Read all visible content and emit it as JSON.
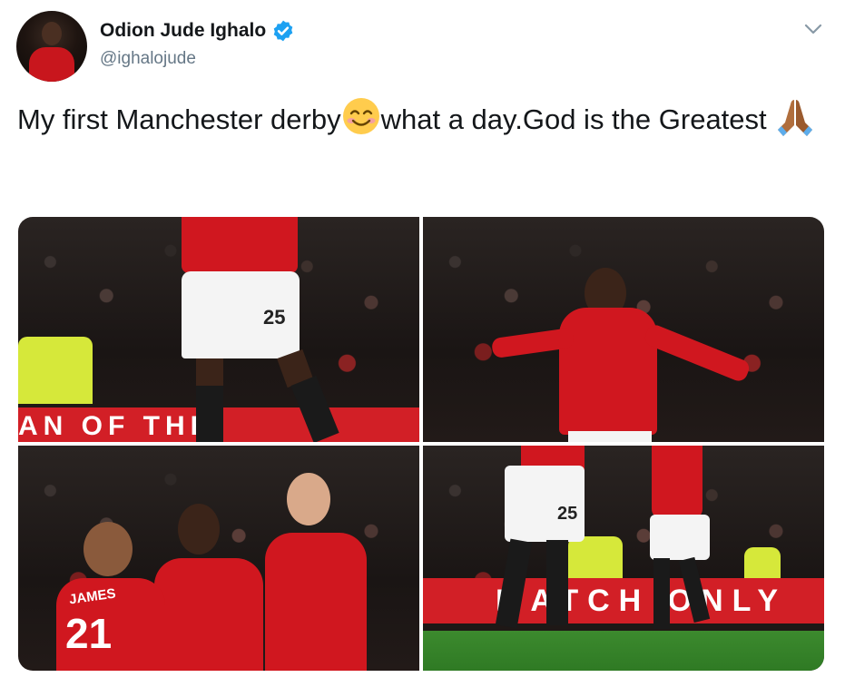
{
  "author": {
    "display_name": "Odion Jude Ighalo",
    "handle": "@ighalojude",
    "verified": true
  },
  "tweet": {
    "text_part1": "My first Manchester derby",
    "text_part2": "what a day.God is the Greatest",
    "emoji_1": "smiling-face-with-smiling-eyes",
    "emoji_2": "folded-hands"
  },
  "media": {
    "photos": [
      {
        "name": "photo-1",
        "shirt_number": "25",
        "board_text": "AN OF THE"
      },
      {
        "name": "photo-2"
      },
      {
        "name": "photo-3",
        "shirt_name": "JAMES",
        "shirt_number": "21"
      },
      {
        "name": "photo-4",
        "shirt_number": "25",
        "board_text": "MATCH ONLY"
      }
    ]
  },
  "colors": {
    "brand_blue": "#1da1f2",
    "united_red": "#d0171f",
    "text_primary": "#14171a",
    "text_secondary": "#657786"
  }
}
